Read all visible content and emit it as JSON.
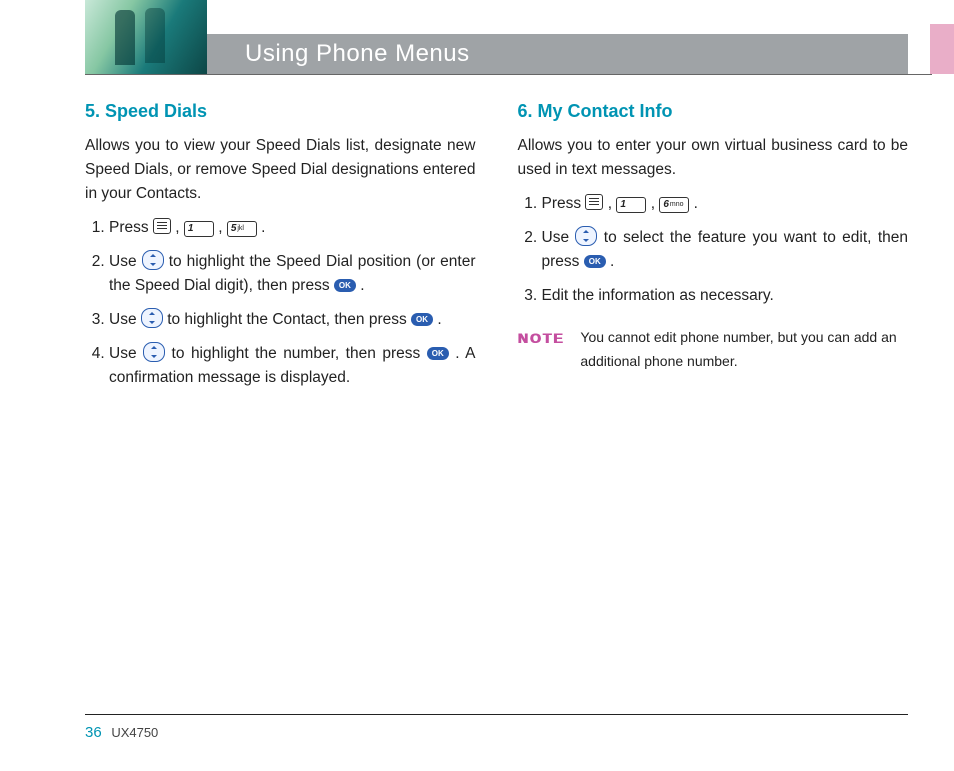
{
  "header": {
    "title": "Using Phone Menus"
  },
  "left": {
    "heading": "5. Speed Dials",
    "intro": "Allows you to view your Speed Dials list, designate new Speed Dials, or remove Speed Dial designations entered in your Contacts.",
    "step1_a": "Press ",
    "step1_b": " , ",
    "step1_c": " , ",
    "step1_d": " .",
    "step2_a": "Use ",
    "step2_b": " to highlight the Speed Dial position (or enter the Speed Dial digit), then press ",
    "step2_c": " .",
    "step3_a": "Use ",
    "step3_b": " to highlight the Contact, then press ",
    "step3_c": " .",
    "step4_a": "Use ",
    "step4_b": " to highlight the number, then press ",
    "step4_c": " . A confirmation message is displayed."
  },
  "right": {
    "heading": "6. My Contact Info",
    "intro": "Allows you to enter your own virtual business card to be used in text messages.",
    "step1_a": "Press ",
    "step1_b": " , ",
    "step1_c": " , ",
    "step1_d": " .",
    "step2_a": "Use ",
    "step2_b": " to select the feature you want to edit, then press ",
    "step2_c": " .",
    "step3": "Edit the information as necessary.",
    "note_label": "NOTE",
    "note_text": "You cannot edit phone number, but you can add an additional phone number."
  },
  "keys": {
    "k1_num": "1",
    "k1_sub": "",
    "k5_num": "5",
    "k5_sub": "jkl",
    "k6_num": "6",
    "k6_sub": "mno",
    "ok": "OK"
  },
  "footer": {
    "page": "36",
    "model": "UX4750"
  }
}
